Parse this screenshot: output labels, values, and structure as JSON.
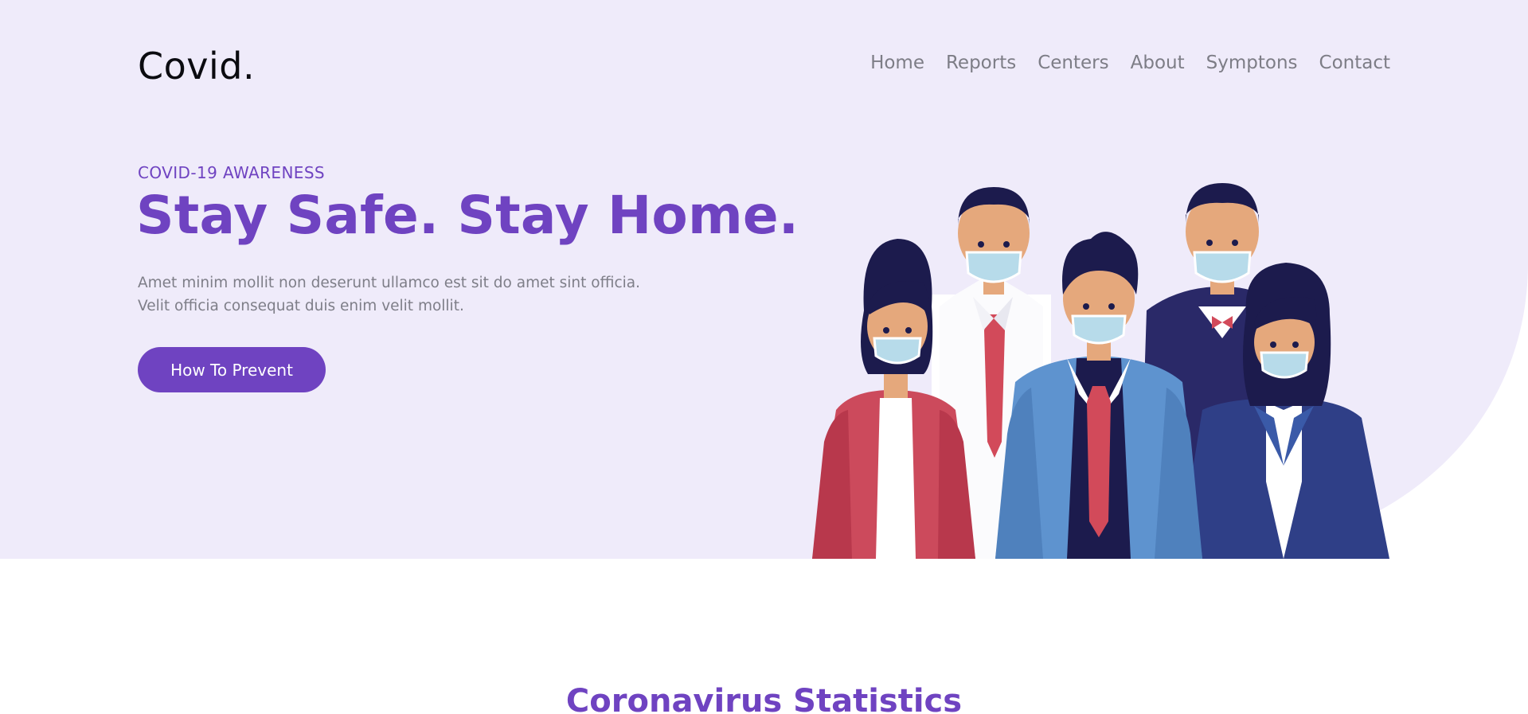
{
  "brand": {
    "logo": "Covid."
  },
  "nav": {
    "items": [
      {
        "label": "Home"
      },
      {
        "label": "Reports"
      },
      {
        "label": "Centers"
      },
      {
        "label": "About"
      },
      {
        "label": "Symptons"
      },
      {
        "label": "Contact"
      }
    ]
  },
  "hero": {
    "eyebrow": "COVID-19 AWARENESS",
    "headline": "Stay Safe. Stay Home.",
    "description_line1": "Amet minim mollit non deserunt ullamco est sit do amet sint officia.",
    "description_line2": "Velit officia consequat duis enim velit mollit.",
    "cta_label": "How To Prevent",
    "illustration_icon": "masked-people-illustration"
  },
  "stats": {
    "title": "Coronavirus Statistics"
  },
  "colors": {
    "accent": "#6f43c1",
    "hero_background": "#efebfa",
    "nav_text": "#7d7d86",
    "body_text": "#7e7e88"
  }
}
